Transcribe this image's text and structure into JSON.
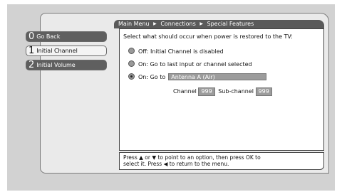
{
  "breadcrumb": {
    "items": [
      "Main Menu",
      "Connections",
      "Special Features"
    ],
    "separator": "▶"
  },
  "sidebar": {
    "items": [
      {
        "number": "0",
        "label": "Go Back",
        "state": "dark"
      },
      {
        "number": "1",
        "label": "Initial Channel",
        "state": "selected"
      },
      {
        "number": "2",
        "label": "Initial Volume",
        "state": "dark"
      }
    ]
  },
  "panel": {
    "prompt": "Select what should occur when power is restored to the TV:",
    "options": [
      {
        "label": "Off: Initial Channel is disabled",
        "selected": false
      },
      {
        "label": "On: Go to last input or channel selected",
        "selected": false
      },
      {
        "label": "On: Go to",
        "selected": true
      }
    ],
    "source_value": "Antenna A (Air)",
    "channel_label": "Channel",
    "channel_value": "999",
    "subchannel_label": "Sub-channel",
    "subchannel_value": "999"
  },
  "help": {
    "line1": "Press ▲ or ▼ to point to an option, then press OK to",
    "line2": "select it. Press ◀ to return to the menu."
  },
  "colors": {
    "background": "#d2d2d2",
    "accent_dark": "#5f5f5f",
    "field": "#9c9c9c"
  }
}
